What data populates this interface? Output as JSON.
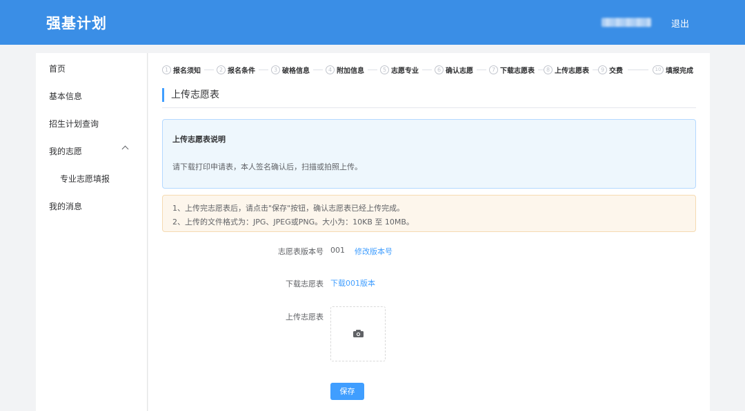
{
  "header": {
    "brand": "强基计划",
    "logout_label": "退出"
  },
  "sidebar": {
    "items": [
      {
        "label": "首页"
      },
      {
        "label": "基本信息"
      },
      {
        "label": "招生计划查询"
      },
      {
        "label": "我的志愿"
      },
      {
        "label": "专业志愿填报"
      },
      {
        "label": "我的消息"
      }
    ],
    "expanded_icon": "chevron-up-icon"
  },
  "steps": [
    {
      "num": "1",
      "label": "报名须知"
    },
    {
      "num": "2",
      "label": "报名条件"
    },
    {
      "num": "3",
      "label": "破格信息"
    },
    {
      "num": "4",
      "label": "附加信息"
    },
    {
      "num": "5",
      "label": "志愿专业"
    },
    {
      "num": "6",
      "label": "确认志愿"
    },
    {
      "num": "7",
      "label": "下载志愿表"
    },
    {
      "num": "8",
      "label": "上传志愿表"
    },
    {
      "num": "9",
      "label": "交费"
    },
    {
      "num": "10",
      "label": "填报完成"
    }
  ],
  "section_title": "上传志愿表",
  "info": {
    "title": "上传志愿表说明",
    "text": "请下载打印申请表，本人签名确认后，扫描或拍照上传。"
  },
  "warning": {
    "line1": "1、上传完志愿表后，请点击\"保存\"按钮，确认志愿表已经上传完成。",
    "line2": "2、上传的文件格式为：JPG、JPEG或PNG。大小为：10KB 至 10MB。"
  },
  "form": {
    "version_label": "志愿表版本号",
    "version_value": "001",
    "modify_version_link": "修改版本号",
    "download_label": "下载志愿表",
    "download_link": "下载001版本",
    "upload_label": "上传志愿表",
    "upload_icon": "camera-icon"
  },
  "save_label": "保存",
  "colors": {
    "header": "#3a8ee6",
    "primary": "#409eff",
    "info_bg": "#eef7fd",
    "warn_bg": "#fdf6ec"
  }
}
